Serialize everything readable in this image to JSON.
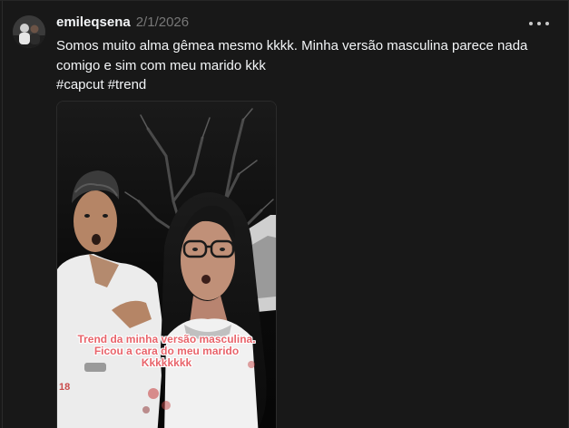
{
  "post": {
    "username": "emileqsena",
    "timestamp": "2/1/2026",
    "caption_lines": [
      "Somos muito alma gêmea mesmo kkkk. Minha versão masculina parece nada",
      "comigo e sim com meu marido kkk"
    ],
    "hashtags": [
      "#capcut",
      "#trend"
    ],
    "more_icon": "more-horizontal-icon"
  },
  "media": {
    "overlay_lines": [
      "Trend da minha versão masculina.",
      "Ficou a cara do meu marido",
      "Kkkkkkkk"
    ],
    "overlay_color": "#e8646b"
  },
  "colors": {
    "background": "#181818",
    "text": "#f3f5f7",
    "muted": "#777777"
  }
}
